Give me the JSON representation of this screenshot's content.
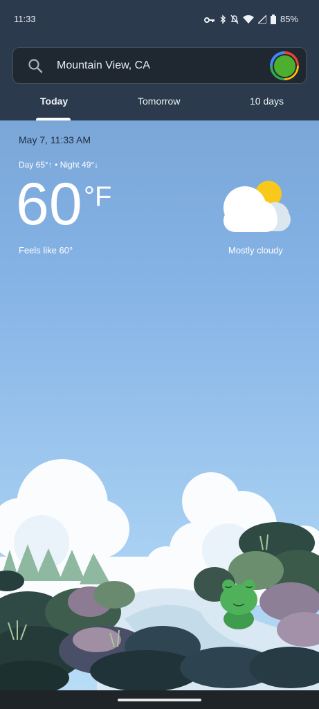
{
  "status_bar": {
    "time": "11:33",
    "battery": "85%"
  },
  "search": {
    "location": "Mountain View, CA"
  },
  "tabs": [
    {
      "label": "Today",
      "selected": true
    },
    {
      "label": "Tomorrow",
      "selected": false
    },
    {
      "label": "10 days",
      "selected": false
    }
  ],
  "weather": {
    "datetime": "May 7, 11:33 AM",
    "day_night": "Day 65°↑ • Night 49°↓",
    "temperature": "60",
    "unit": "°F",
    "feels_like": "Feels like 60°",
    "condition": "Mostly cloudy",
    "icon": "partly-cloudy-icon"
  },
  "colors": {
    "header_bg": "#2b3a4c",
    "sky_top": "#7aa6d8",
    "sky_bottom": "#b7dcf6",
    "accent": "#ffffff"
  }
}
